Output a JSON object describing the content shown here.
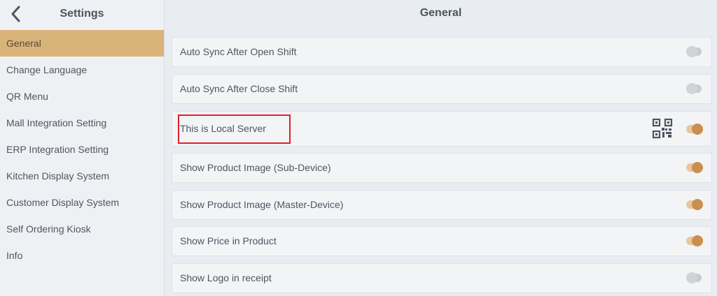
{
  "sidebar": {
    "title": "Settings",
    "items": [
      {
        "label": "General",
        "active": true
      },
      {
        "label": "Change Language"
      },
      {
        "label": "QR Menu"
      },
      {
        "label": "Mall Integration Setting"
      },
      {
        "label": "ERP Integration Setting"
      },
      {
        "label": "Kitchen Display System"
      },
      {
        "label": "Customer Display System"
      },
      {
        "label": "Self Ordering Kiosk"
      },
      {
        "label": "Info"
      }
    ]
  },
  "main": {
    "title": "General",
    "rows": [
      {
        "label": "Auto Sync After Open Shift",
        "enabled": false
      },
      {
        "label": "Auto Sync After Close Shift",
        "enabled": false
      },
      {
        "label": "This is Local Server",
        "enabled": true,
        "has_qr": true
      },
      {
        "label": "Show Product Image (Sub-Device)",
        "enabled": true
      },
      {
        "label": "Show Product Image (Master-Device)",
        "enabled": true
      },
      {
        "label": "Show Price in Product",
        "enabled": true
      },
      {
        "label": "Show Logo in receipt",
        "enabled": false
      }
    ]
  },
  "colors": {
    "accent": "#d9b47a",
    "toggle_on": "#c98f4e",
    "highlight": "#e0202a"
  },
  "icons": {
    "back": "chevron-left-icon",
    "qr": "qr-code-icon"
  }
}
